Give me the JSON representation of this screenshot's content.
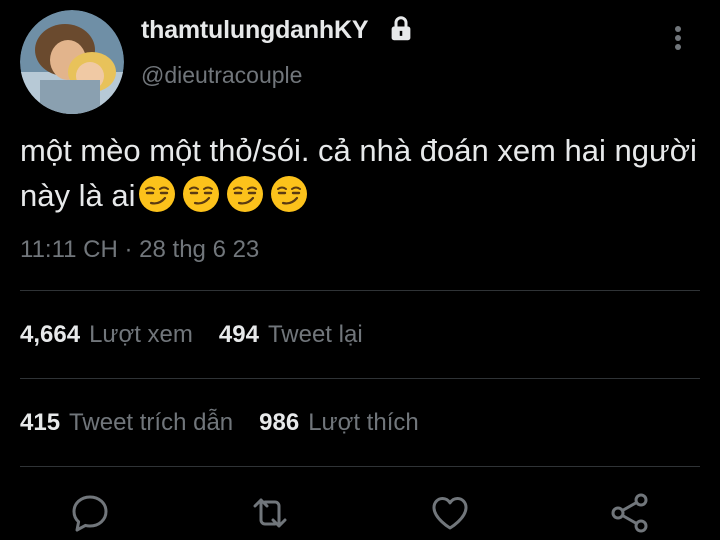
{
  "user": {
    "display_name": "thamtulungdanhKY",
    "handle": "@dieutracouple",
    "protected": true
  },
  "tweet": {
    "text": "một mèo một thỏ/sói. cả nhà đoán xem hai người này là ai",
    "emoji": [
      "smirking-face",
      "smirking-face",
      "smirking-face",
      "smirking-face"
    ],
    "time": "11:11 CH",
    "separator": "·",
    "date": "28 thg 6 23"
  },
  "stats": {
    "views": {
      "count": "4,664",
      "label": "Lượt xem"
    },
    "retweets": {
      "count": "494",
      "label": "Tweet lại"
    },
    "quotes": {
      "count": "415",
      "label": "Tweet trích dẫn"
    },
    "likes": {
      "count": "986",
      "label": "Lượt thích"
    }
  },
  "actions": [
    "reply-icon",
    "retweet-icon",
    "like-icon",
    "share-icon"
  ],
  "colors": {
    "background": "#000000",
    "primary_text": "#e7e9ea",
    "secondary_text": "#71767b",
    "divider": "#2f3336"
  }
}
